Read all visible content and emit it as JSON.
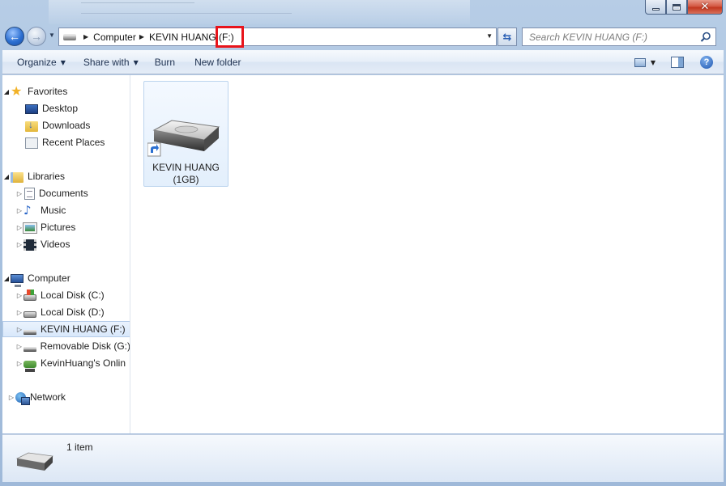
{
  "window": {
    "caption_buttons": [
      "minimize",
      "maximize",
      "close"
    ]
  },
  "address_bar": {
    "crumbs": [
      "Computer",
      "KEVIN HUANG",
      "(F:)"
    ],
    "highlight_color": "#e8141b"
  },
  "search": {
    "placeholder": "Search KEVIN HUANG (F:)"
  },
  "toolbar": {
    "organize": "Organize",
    "share_with": "Share with",
    "burn": "Burn",
    "new_folder": "New folder"
  },
  "nav": {
    "favorites": {
      "label": "Favorites",
      "items": [
        {
          "label": "Desktop",
          "icon": "desktop-icon"
        },
        {
          "label": "Downloads",
          "icon": "downloads-folder-icon"
        },
        {
          "label": "Recent Places",
          "icon": "recent-places-icon"
        }
      ]
    },
    "libraries": {
      "label": "Libraries",
      "items": [
        {
          "label": "Documents",
          "icon": "documents-icon"
        },
        {
          "label": "Music",
          "icon": "music-icon"
        },
        {
          "label": "Pictures",
          "icon": "pictures-icon"
        },
        {
          "label": "Videos",
          "icon": "videos-icon"
        }
      ]
    },
    "computer": {
      "label": "Computer",
      "items": [
        {
          "label": "Local Disk (C:)",
          "icon": "system-disk-icon"
        },
        {
          "label": "Local Disk (D:)",
          "icon": "local-disk-icon"
        },
        {
          "label": "KEVIN HUANG (F:)",
          "icon": "removable-drive-icon",
          "selected": true
        },
        {
          "label": "Removable Disk (G:)",
          "icon": "removable-drive-icon"
        },
        {
          "label": "KevinHuang's Onlin",
          "icon": "network-drive-icon"
        }
      ]
    },
    "network": {
      "label": "Network"
    }
  },
  "files": [
    {
      "name": "KEVIN HUANG",
      "size": "(1GB)",
      "icon": "drive-shortcut-icon"
    }
  ],
  "details": {
    "count": "1 item"
  }
}
